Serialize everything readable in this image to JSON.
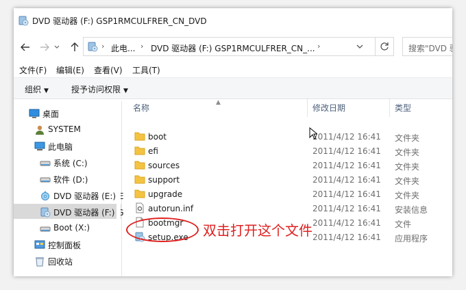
{
  "window": {
    "title": "DVD 驱动器 (F:) GSP1RMCULFRER_CN_DVD"
  },
  "navbar": {
    "back_label": "后退",
    "forward_label": "前进",
    "up_label": "向上",
    "breadcrumb": [
      "此电...",
      "DVD 驱动器 (F:) GSP1RMCULFRER_CN_..."
    ],
    "search_placeholder": "搜索\"DVD 驱"
  },
  "menu": {
    "items": [
      "文件(F)",
      "编辑(E)",
      "查看(V)",
      "工具(T)"
    ]
  },
  "toolbar": {
    "organize": "组织",
    "grant_access": "授予访问权限"
  },
  "sidebar": {
    "items": [
      {
        "label": "桌面",
        "icon": "desktop-icon"
      },
      {
        "label": "SYSTEM",
        "icon": "user-icon"
      },
      {
        "label": "此电脑",
        "icon": "computer-icon"
      },
      {
        "label": "系统 (C:)",
        "icon": "drive-icon"
      },
      {
        "label": "软件 (D:)",
        "icon": "drive-icon"
      },
      {
        "label": "DVD 驱动器 (E:) E",
        "icon": "dvd-icon"
      },
      {
        "label": "DVD 驱动器 (F:) G",
        "icon": "dvd-setup-icon",
        "selected": true
      },
      {
        "label": "Boot (X:)",
        "icon": "drive-icon"
      },
      {
        "label": "控制面板",
        "icon": "control-panel-icon"
      },
      {
        "label": "回收站",
        "icon": "recycle-bin-icon"
      }
    ]
  },
  "columns": {
    "name": "名称",
    "date": "修改日期",
    "type": "类型"
  },
  "files": [
    {
      "name": "boot",
      "date": "2011/4/12 16:41",
      "type": "文件夹",
      "icon": "folder-icon"
    },
    {
      "name": "efi",
      "date": "2011/4/12 16:41",
      "type": "文件夹",
      "icon": "folder-icon"
    },
    {
      "name": "sources",
      "date": "2011/4/12 16:41",
      "type": "文件夹",
      "icon": "folder-icon"
    },
    {
      "name": "support",
      "date": "2011/4/12 16:41",
      "type": "文件夹",
      "icon": "folder-icon"
    },
    {
      "name": "upgrade",
      "date": "2011/4/12 16:41",
      "type": "文件夹",
      "icon": "folder-icon"
    },
    {
      "name": "autorun.inf",
      "date": "2011/4/12 16:41",
      "type": "安装信息",
      "icon": "settings-file-icon"
    },
    {
      "name": "bootmgr",
      "date": "2011/4/12 16:41",
      "type": "文件",
      "icon": "file-icon"
    },
    {
      "name": "setup.exe",
      "date": "2011/4/12 16:41",
      "type": "应用程序",
      "icon": "setup-exe-icon"
    }
  ],
  "annotation": {
    "text": "双击打开这个文件",
    "color": "#e02020"
  },
  "colors": {
    "folder": "#f5c342",
    "selected_bg": "#d9d9d9",
    "header_text": "#4c607a"
  }
}
